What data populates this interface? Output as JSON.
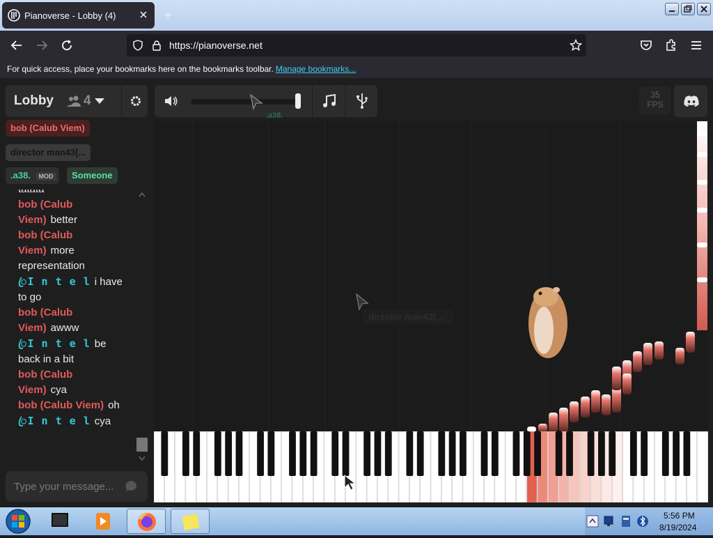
{
  "browser": {
    "tab_title": "Pianoverse - Lobby (4)",
    "new_tab_label": "+",
    "url": "https://pianoverse.net",
    "bookmarks_hint": "For quick access, place your bookmarks here on the bookmarks toolbar.",
    "manage_bookmarks": "Manage bookmarks..."
  },
  "room": {
    "name": "Lobby",
    "user_count": "4"
  },
  "toolbar": {
    "volume_level": 1.0,
    "cursor_label": ".a38."
  },
  "fps": {
    "value": "35",
    "label": "FPS"
  },
  "users": [
    {
      "name": "bob (Calub Viem)",
      "color": "#f06b6b",
      "bg": "#4a2020"
    },
    {
      "name": "director man43[...",
      "color": "#111111",
      "bg": "#3a3a3a"
    },
    {
      "name": ".a38.",
      "color": "#3fd29a",
      "bg": "#2e2e2e",
      "badge": "MOD"
    },
    {
      "name": "Someone",
      "color": "#59e0a0",
      "bg": "#2f3b35"
    }
  ],
  "chat": {
    "messages": [
      {
        "name": "",
        "text": "tatata",
        "color": "#eaeaea"
      },
      {
        "name": "bob (Calub Viem)",
        "text": "better",
        "color": "#e05a5a"
      },
      {
        "name": "bob (Calub Viem)",
        "text": "more representation",
        "color": "#e05a5a"
      },
      {
        "name": "ꦿI n t e l",
        "text": "i have to go",
        "color": "#38c6d6"
      },
      {
        "name": "bob (Calub Viem)",
        "text": "awww",
        "color": "#e05a5a"
      },
      {
        "name": "ꦿI n t e l",
        "text": "be back in a bit",
        "color": "#38c6d6"
      },
      {
        "name": "bob (Calub Viem)",
        "text": "cya",
        "color": "#e05a5a"
      },
      {
        "name": "bob (Calub Viem)",
        "text": "oh",
        "color": "#e05a5a"
      },
      {
        "name": "ꦿI n t e l",
        "text": "cya",
        "color": "#38c6d6"
      }
    ],
    "input_placeholder": "Type your message..."
  },
  "stage": {
    "cursor_label": "director man43[..."
  },
  "taskbar": {
    "time": "5:56 PM",
    "date": "8/19/2024"
  }
}
